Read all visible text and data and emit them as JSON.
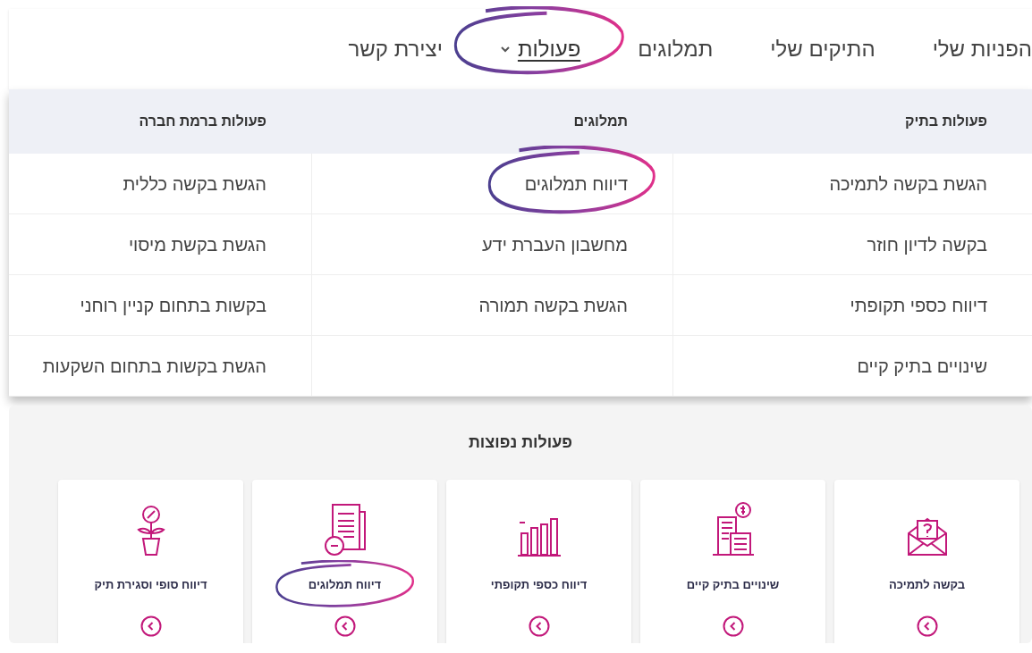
{
  "nav": [
    {
      "label": "הפניות שלי",
      "selected": false,
      "dropdown": false,
      "highlighted": false
    },
    {
      "label": "התיקים שלי",
      "selected": false,
      "dropdown": false,
      "highlighted": false
    },
    {
      "label": "תמלוגים",
      "selected": false,
      "dropdown": false,
      "highlighted": false
    },
    {
      "label": "פעולות",
      "selected": true,
      "dropdown": true,
      "highlighted": true
    },
    {
      "label": "יצירת קשר",
      "selected": false,
      "dropdown": false,
      "highlighted": false
    }
  ],
  "menu": {
    "columns": [
      {
        "title": "פעולות בתיק",
        "items": [
          {
            "label": "הגשת בקשה לתמיכה",
            "highlighted": false
          },
          {
            "label": "בקשה לדיון חוזר",
            "highlighted": false
          },
          {
            "label": "דיווח כספי תקופתי",
            "highlighted": false
          },
          {
            "label": "שינויים בתיק קיים",
            "highlighted": false
          }
        ]
      },
      {
        "title": "תמלוגים",
        "items": [
          {
            "label": "דיווח תמלוגים",
            "highlighted": true
          },
          {
            "label": "מחשבון העברת ידע",
            "highlighted": false
          },
          {
            "label": "הגשת בקשה תמורה",
            "highlighted": false
          }
        ]
      },
      {
        "title": "פעולות ברמת חברה",
        "items": [
          {
            "label": "הגשת בקשה כללית",
            "highlighted": false
          },
          {
            "label": "הגשת בקשת מיסוי",
            "highlighted": false
          },
          {
            "label": "בקשות בתחום קניין רוחני",
            "highlighted": false
          },
          {
            "label": "הגשת בקשות בתחום השקעות",
            "highlighted": false
          }
        ]
      }
    ]
  },
  "common_actions": {
    "title": "פעולות נפוצות",
    "cards": [
      {
        "kind": "envelope",
        "label": "בקשה לתמיכה",
        "highlighted": false
      },
      {
        "kind": "building",
        "label": "שינויים בתיק קיים",
        "highlighted": false
      },
      {
        "kind": "chart",
        "label": "דיווח כספי תקופתי",
        "highlighted": false
      },
      {
        "kind": "document",
        "label": "דיווח תמלוגים",
        "highlighted": true
      },
      {
        "kind": "plant",
        "label": "דיווח סופי וסגירת תיק",
        "highlighted": false
      }
    ]
  }
}
